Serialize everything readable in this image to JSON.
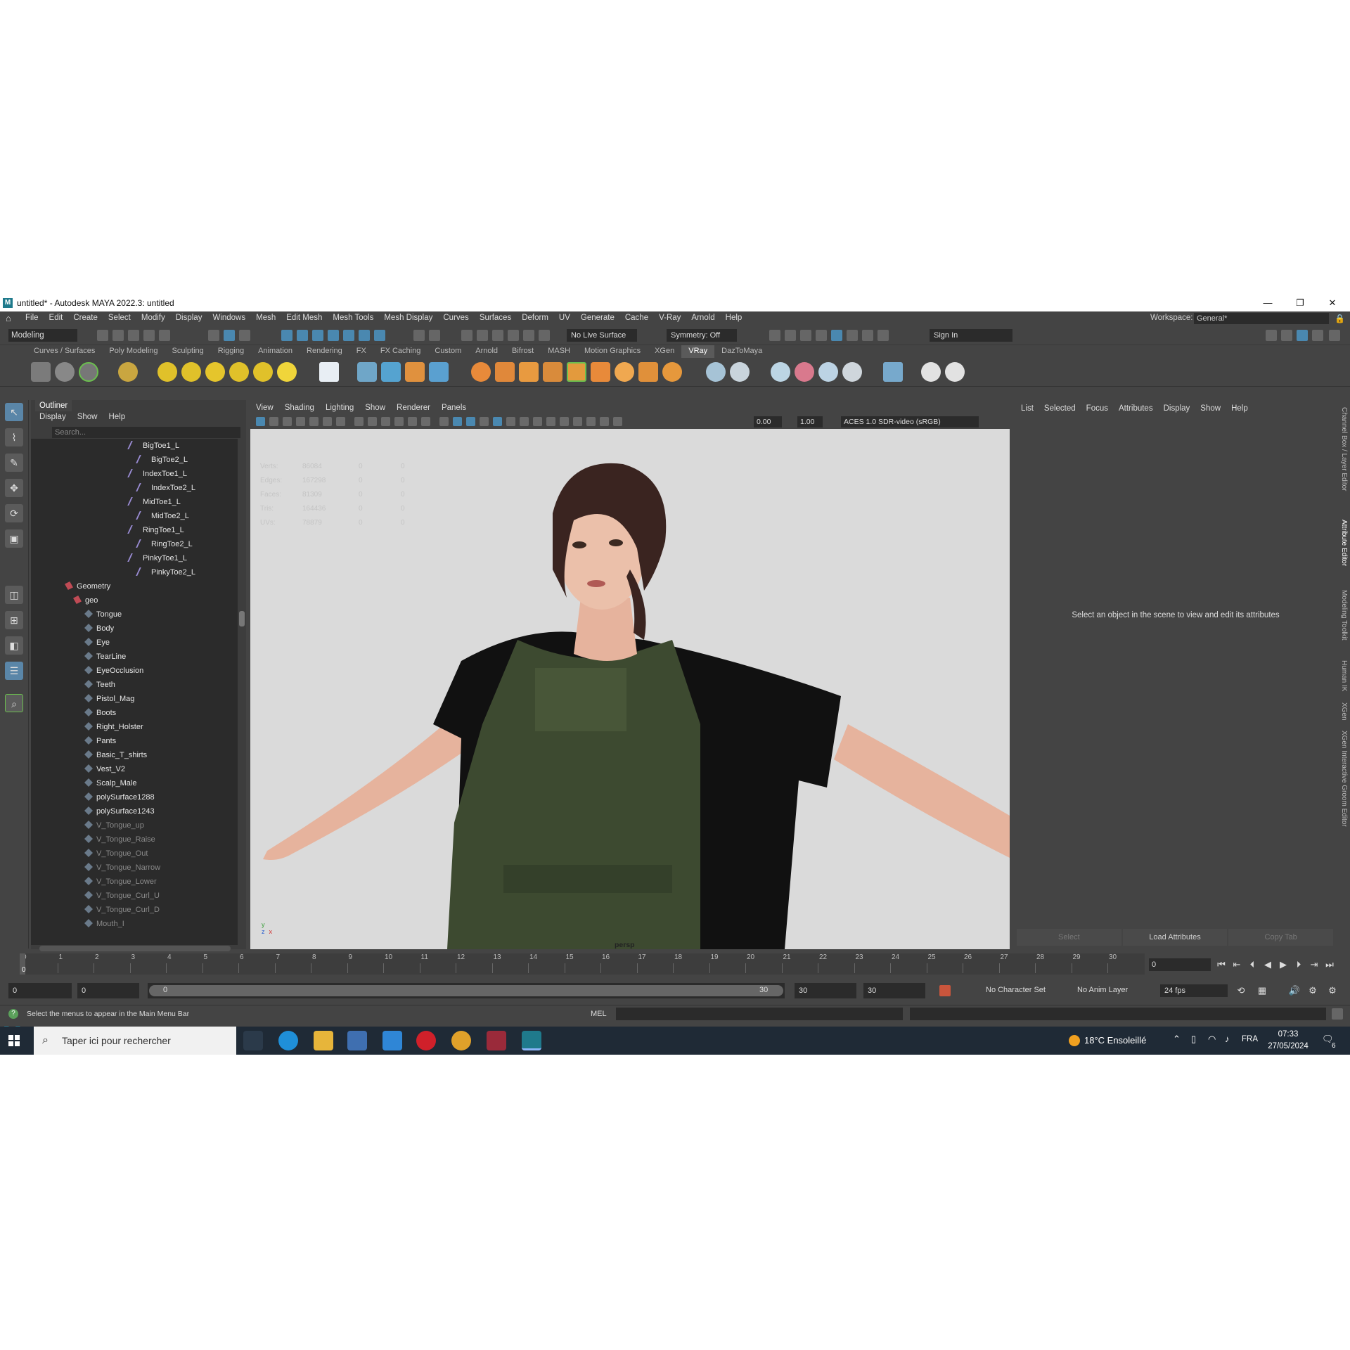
{
  "window": {
    "title": "untitled* - Autodesk MAYA 2022.3: untitled",
    "logo_letter": "M",
    "minimize": "—",
    "maximize": "❐",
    "close": "✕"
  },
  "menubar": {
    "items": [
      "File",
      "Edit",
      "Create",
      "Select",
      "Modify",
      "Display",
      "Windows",
      "Mesh",
      "Edit Mesh",
      "Mesh Tools",
      "Mesh Display",
      "Curves",
      "Surfaces",
      "Deform",
      "UV",
      "Generate",
      "Cache",
      "V-Ray",
      "Arnold",
      "Help"
    ],
    "workspace_label": "Workspace:",
    "workspace_value": "General*"
  },
  "statusline": {
    "mode": "Modeling",
    "live_surface": "No Live Surface",
    "symmetry": "Symmetry: Off",
    "sign_in": "Sign In"
  },
  "shelf": {
    "tabs": [
      "Curves / Surfaces",
      "Poly Modeling",
      "Sculpting",
      "Rigging",
      "Animation",
      "Rendering",
      "FX",
      "FX Caching",
      "Custom",
      "Arnold",
      "Bifrost",
      "MASH",
      "Motion Graphics",
      "XGen",
      "VRay",
      "DazToMaya"
    ],
    "active_tab": "VRay"
  },
  "outliner": {
    "tab": "Outliner",
    "menu": [
      "Display",
      "Show",
      "Help"
    ],
    "search_placeholder": "Search...",
    "joints": [
      {
        "label": "BigToe1_L",
        "level": 0
      },
      {
        "label": "BigToe2_L",
        "level": 1
      },
      {
        "label": "IndexToe1_L",
        "level": 0
      },
      {
        "label": "IndexToe2_L",
        "level": 1
      },
      {
        "label": "MidToe1_L",
        "level": 0
      },
      {
        "label": "MidToe2_L",
        "level": 1
      },
      {
        "label": "RingToe1_L",
        "level": 0
      },
      {
        "label": "RingToe2_L",
        "level": 1
      },
      {
        "label": "PinkyToe1_L",
        "level": 0
      },
      {
        "label": "PinkyToe2_L",
        "level": 1
      }
    ],
    "groups": [
      "Geometry",
      "geo"
    ],
    "meshes": [
      "Tongue",
      "Body",
      "Eye",
      "TearLine",
      "EyeOcclusion",
      "Teeth",
      "Pistol_Mag",
      "Boots",
      "Right_Holster",
      "Pants",
      "Basic_T_shirts",
      "Vest_V2",
      "Scalp_Male",
      "polySurface1288",
      "polySurface1243"
    ],
    "hidden_meshes": [
      "V_Tongue_up",
      "V_Tongue_Raise",
      "V_Tongue_Out",
      "V_Tongue_Narrow",
      "V_Tongue_Lower",
      "V_Tongue_Curl_U",
      "V_Tongue_Curl_D",
      "Mouth_I"
    ]
  },
  "viewport": {
    "menu": [
      "View",
      "Shading",
      "Lighting",
      "Show",
      "Renderer",
      "Panels"
    ],
    "exposure": "0.00",
    "gamma": "1.00",
    "color_space": "ACES 1.0 SDR-video (sRGB)",
    "hud": [
      {
        "label": "Verts:",
        "v1": "86084",
        "v2": "0",
        "v3": "0"
      },
      {
        "label": "Edges:",
        "v1": "167298",
        "v2": "0",
        "v3": "0"
      },
      {
        "label": "Faces:",
        "v1": "81309",
        "v2": "0",
        "v3": "0"
      },
      {
        "label": "Tris:",
        "v1": "164436",
        "v2": "0",
        "v3": "0"
      },
      {
        "label": "UVs:",
        "v1": "78879",
        "v2": "0",
        "v3": "0"
      }
    ],
    "camera": "persp",
    "axis_y": "y",
    "axis_z": "z",
    "axis_x": "x"
  },
  "attribute_editor": {
    "menu": [
      "List",
      "Selected",
      "Focus",
      "Attributes",
      "Display",
      "Show",
      "Help"
    ],
    "message": "Select an object in the scene to view and edit its attributes",
    "buttons": [
      "Select",
      "Load Attributes",
      "Copy Tab"
    ],
    "side_tabs": [
      "Channel Box / Layer Editor",
      "Attribute Editor",
      "Modeling Toolkit",
      "Human IK",
      "XGen",
      "XGen Interactive Groom Editor"
    ]
  },
  "timeline": {
    "ticks": [
      "0",
      "1",
      "2",
      "3",
      "4",
      "5",
      "6",
      "7",
      "8",
      "9",
      "10",
      "11",
      "12",
      "13",
      "14",
      "15",
      "16",
      "17",
      "18",
      "19",
      "20",
      "21",
      "22",
      "23",
      "24",
      "25",
      "26",
      "27",
      "28",
      "29",
      "30"
    ],
    "current_frame_label": "0",
    "current_frame_field": "0",
    "range_start": "0",
    "playback_start": "0",
    "slider_start": "0",
    "slider_end": "30",
    "playback_end": "30",
    "range_end": "30",
    "character_set": "No Character Set",
    "anim_layer": "No Anim Layer",
    "fps": "24 fps"
  },
  "commandline": {
    "help": "Select the menus to appear in the Main Menu Bar",
    "language": "MEL"
  },
  "taskbar": {
    "search_placeholder": "Taper ici pour rechercher",
    "weather": "18°C  Ensoleillé",
    "language": "FRA",
    "time": "07:33",
    "date": "27/05/2024",
    "notifications": "6"
  }
}
